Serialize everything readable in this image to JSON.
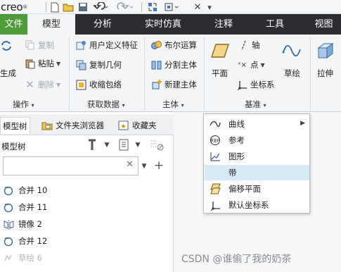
{
  "app": {
    "logo": "creo",
    "logo_mark": "®"
  },
  "quick_access": {
    "overflow_icon": "close-icon"
  },
  "tabs": [
    {
      "label": "文件",
      "state": "file"
    },
    {
      "label": "模型",
      "state": "active"
    },
    {
      "label": "分析",
      "state": "normal"
    },
    {
      "label": "实时仿真",
      "state": "normal"
    },
    {
      "label": "注释",
      "state": "normal"
    },
    {
      "label": "工具",
      "state": "normal"
    },
    {
      "label": "视图",
      "state": "normal"
    }
  ],
  "ribbon": {
    "operations": {
      "regenerate_label": "生成",
      "copy_label": "复制",
      "paste_label": "粘贴",
      "delete_label": "删除",
      "group_label": "操作"
    },
    "get_data": {
      "udf_label": "用户定义特征",
      "copy_geom_label": "复制几何",
      "shrinkwrap_label": "收缩包络",
      "group_label": "获取数据"
    },
    "body": {
      "boolean_label": "布尔运算",
      "split_label": "分割主体",
      "new_body_label": "新建主体",
      "group_label": "主体"
    },
    "datum": {
      "plane_label": "平面",
      "axis_label": "轴",
      "point_label": "点",
      "csys_label": "坐标系",
      "sketch_label": "草绘",
      "group_label": "基准"
    },
    "shapes": {
      "extrude_label": "拉伸"
    }
  },
  "datum_menu": {
    "items": [
      {
        "label": "曲线",
        "icon": "curve-icon",
        "has_submenu": true,
        "highlighted": false
      },
      {
        "label": "参考",
        "icon": "reference-icon",
        "has_submenu": false,
        "highlighted": false
      },
      {
        "label": "图形",
        "icon": "graph-icon",
        "has_submenu": false,
        "highlighted": false
      },
      {
        "label": "带",
        "icon": "",
        "has_submenu": false,
        "highlighted": true
      },
      {
        "label": "偏移平面",
        "icon": "offset-plane-icon",
        "has_submenu": false,
        "highlighted": false
      },
      {
        "label": "默认坐标系",
        "icon": "default-csys-icon",
        "has_submenu": false,
        "highlighted": false
      }
    ]
  },
  "panel": {
    "tabs": [
      {
        "label": "模型树",
        "active": true
      },
      {
        "label": "文件夹浏览器",
        "active": false
      },
      {
        "label": "收藏夹",
        "active": false
      }
    ],
    "tree_title": "模型树",
    "filter": {
      "value": "",
      "placeholder": ""
    },
    "items": [
      {
        "label": "合并 10",
        "icon": "merge-icon",
        "dimmed": false
      },
      {
        "label": "合并 11",
        "icon": "merge-icon",
        "dimmed": false
      },
      {
        "label": "镜像 2",
        "icon": "mirror-icon",
        "dimmed": false
      },
      {
        "label": "合并 12",
        "icon": "merge-icon",
        "dimmed": false
      },
      {
        "label": "草绘 6",
        "icon": "sketch-icon",
        "dimmed": true
      }
    ]
  },
  "watermark": "CSDN @谁偷了我的奶茶",
  "colors": {
    "file_tab": "#4e9b3a",
    "tab_bar": "#2b2d31",
    "menu_highlight": "#d7ebf7"
  }
}
